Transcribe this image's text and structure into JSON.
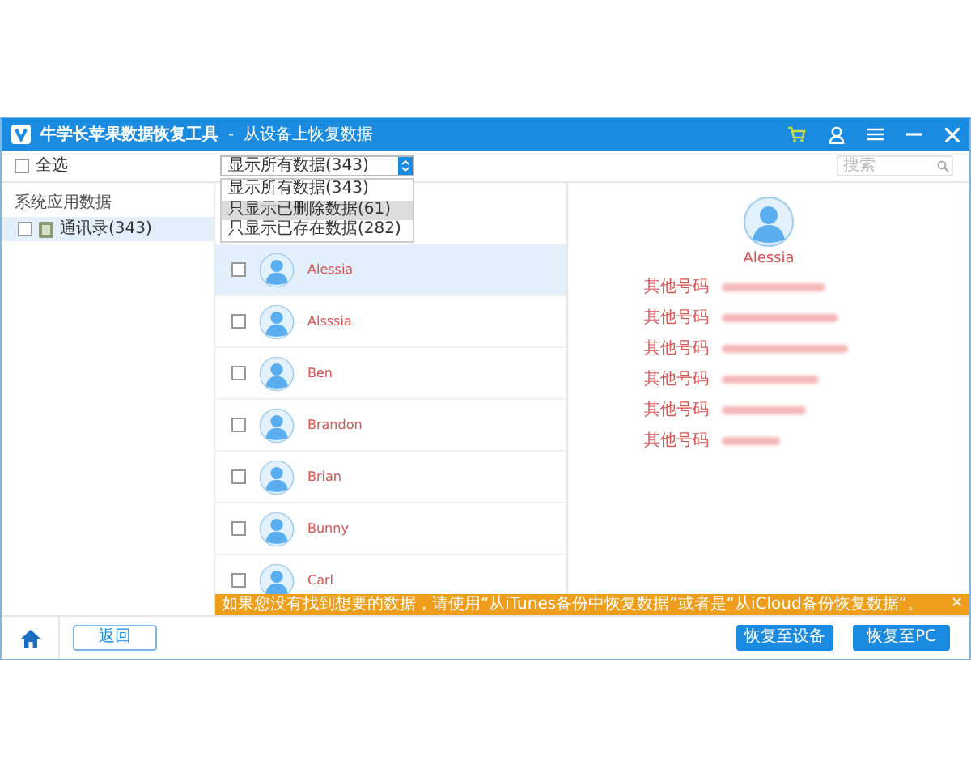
{
  "window": {
    "title": "牛学长苹果数据恢复工具",
    "separator": "-",
    "subtitle": "从设备上恢复数据"
  },
  "select_all": {
    "label": "全选",
    "checked": false
  },
  "filter": {
    "value": "显示所有数据(343)",
    "expanded": true,
    "options": [
      {
        "label": "显示所有数据(343)",
        "highlighted": false
      },
      {
        "label": "只显示已删除数据(61)",
        "highlighted": true
      },
      {
        "label": "只显示已存在数据(282)",
        "highlighted": false
      }
    ]
  },
  "search": {
    "placeholder": "搜索"
  },
  "sidebar": {
    "heading": "系统应用数据",
    "items": [
      {
        "label": "通讯录(343)",
        "checked": false,
        "selected": true
      }
    ]
  },
  "contacts": [
    {
      "name": "Alessia",
      "checked": false,
      "selected": true
    },
    {
      "name": "Alsssia",
      "checked": false,
      "selected": false
    },
    {
      "name": "Ben",
      "checked": false,
      "selected": false
    },
    {
      "name": "Brandon",
      "checked": false,
      "selected": false
    },
    {
      "name": "Brian",
      "checked": false,
      "selected": false
    },
    {
      "name": "Bunny",
      "checked": false,
      "selected": false
    },
    {
      "name": "Carl",
      "checked": false,
      "selected": false
    }
  ],
  "detail": {
    "name": "Alessia",
    "fields": [
      {
        "label": "其他号码"
      },
      {
        "label": "其他号码"
      },
      {
        "label": "其他号码"
      },
      {
        "label": "其他号码"
      },
      {
        "label": "其他号码"
      },
      {
        "label": "其他号码"
      }
    ]
  },
  "banner": {
    "text": "如果您没有找到想要的数据，请使用“从iTunes备份中恢复数据”或者是“从iCloud备份恢复数据”。",
    "close": "✕"
  },
  "footer": {
    "back": "返回",
    "buttons": [
      "恢复至设备",
      "恢复至PC"
    ]
  }
}
